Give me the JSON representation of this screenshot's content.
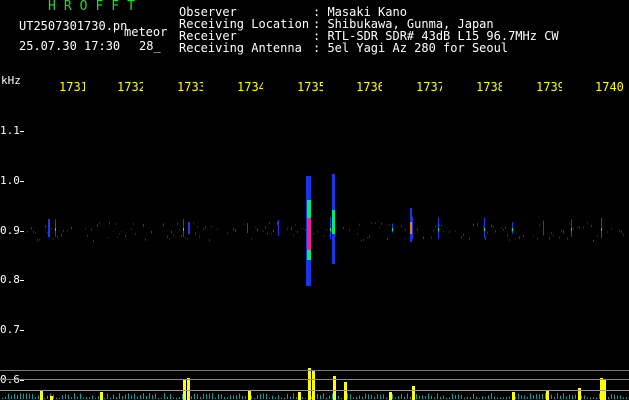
{
  "header": {
    "brand": "HROFFT",
    "filename": "UT2507301730.pn",
    "tag": "meteor",
    "datetime": "25.07.30 17:30",
    "extra": "28_",
    "fields": [
      {
        "label": "Observer",
        "value": ": Masaki Kano"
      },
      {
        "label": "Receiving Location",
        "value": ": Shibukawa, Gunma, Japan"
      },
      {
        "label": "Receiver",
        "value": ": RTL-SDR SDR# 43dB L15 96.7MHz CW"
      },
      {
        "label": "Receiving Antenna",
        "value": ": 5el Yagi Az 280 for Seoul"
      }
    ]
  },
  "axis": {
    "unit": "kHz",
    "y_ticks": [
      "1.1",
      "1.0",
      "0.9",
      "0.8",
      "0.7",
      "0.6"
    ],
    "x_ticks": [
      "1731",
      "1732",
      "1733",
      "1734",
      "1735",
      "1736",
      "1737",
      "1738",
      "1739",
      "1740"
    ]
  },
  "colors": {
    "background": "#000000",
    "brand": "#2bd62b",
    "ticks_x": "#ffff00",
    "signal_strong": "#ff1493",
    "signal_mid": "#00ff66",
    "signal_low": "#1a3dff",
    "trace": "#ffff00",
    "noise": "#00cfcf"
  }
}
